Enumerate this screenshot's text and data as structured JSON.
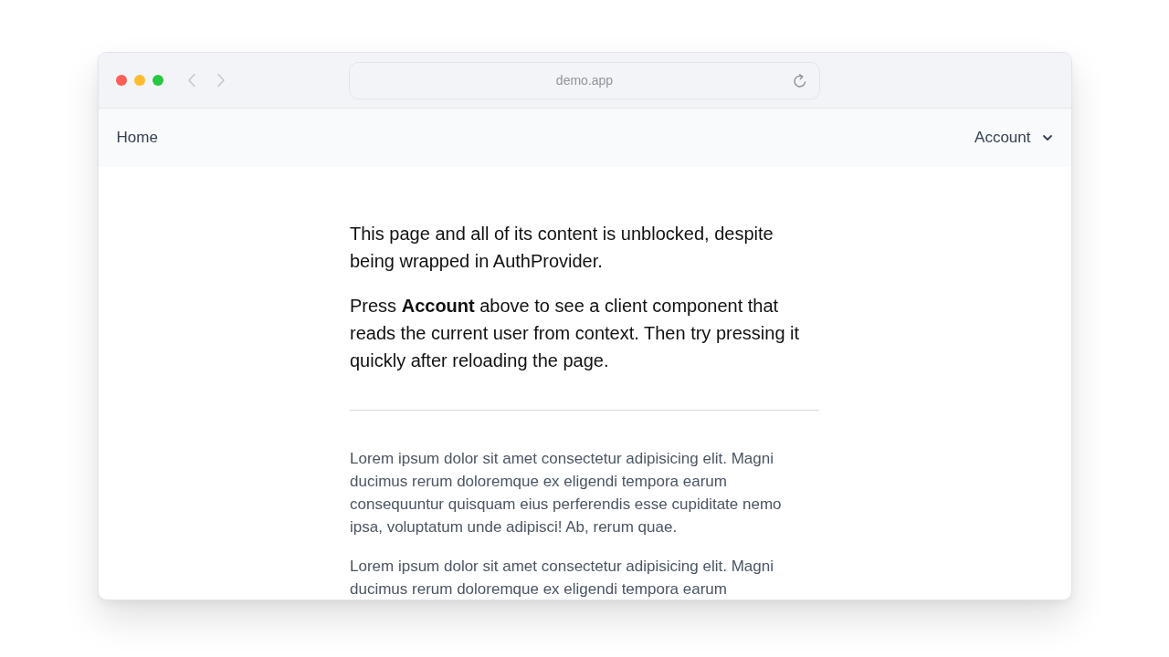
{
  "browser": {
    "address": "demo.app"
  },
  "nav": {
    "links": [
      "Home"
    ],
    "menu": {
      "label": "Account"
    }
  },
  "intro": [
    "This page and all of its content is unblocked, despite being wrapped in AuthProvider.",
    "Press **Account** above to see a client component that reads the current user from context. Then try pressing it quickly after reloading the page."
  ],
  "body": [
    "Lorem ipsum dolor sit amet consectetur adipisicing elit. Magni ducimus rerum doloremque ex eligendi tempora earum consequuntur quisquam eius perferendis esse cupiditate nemo ipsa, voluptatum unde adipisci! Ab, rerum quae.",
    "Lorem ipsum dolor sit amet consectetur adipisicing elit. Magni ducimus rerum doloremque ex eligendi tempora earum"
  ]
}
